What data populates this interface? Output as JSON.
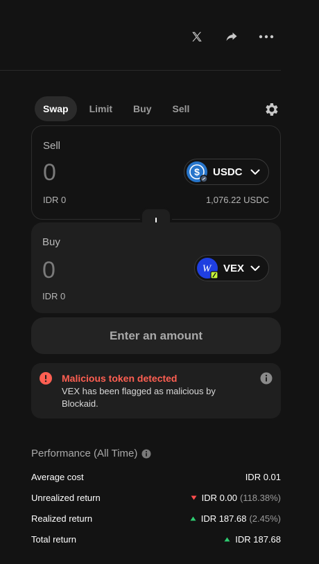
{
  "topbar": {
    "icons": [
      "x-logo-icon",
      "share-icon",
      "more-icon"
    ]
  },
  "tabs": [
    {
      "label": "Swap",
      "active": true
    },
    {
      "label": "Limit",
      "active": false
    },
    {
      "label": "Buy",
      "active": false
    },
    {
      "label": "Sell",
      "active": false
    }
  ],
  "sell": {
    "label": "Sell",
    "amount": "0",
    "fiat": "IDR 0",
    "token": "USDC",
    "balance": "1,076.22 USDC"
  },
  "buy": {
    "label": "Buy",
    "amount": "0",
    "fiat": "IDR 0",
    "token": "VEX"
  },
  "action_button": "Enter an amount",
  "warning": {
    "title": "Malicious token detected",
    "body": "VEX has been flagged as malicious by Blockaid."
  },
  "performance": {
    "title": "Performance (All Time)",
    "rows": [
      {
        "label": "Average cost",
        "value": "IDR 0.01",
        "pct": "",
        "trend": "none"
      },
      {
        "label": "Unrealized return",
        "value": "IDR 0.00",
        "pct": "(118.38%)",
        "trend": "down"
      },
      {
        "label": "Realized return",
        "value": "IDR 187.68",
        "pct": "(2.45%)",
        "trend": "up"
      },
      {
        "label": "Total return",
        "value": "IDR 187.68",
        "pct": "",
        "trend": "up"
      }
    ]
  },
  "colors": {
    "background": "#131313",
    "card": "#1f1f1f",
    "danger": "#ff5f52",
    "up": "#2ecc71",
    "down": "#ff4d4d",
    "usdc": "#2775ca",
    "vex": "#1f3fe0",
    "vex_badge": "#c4f53a"
  }
}
